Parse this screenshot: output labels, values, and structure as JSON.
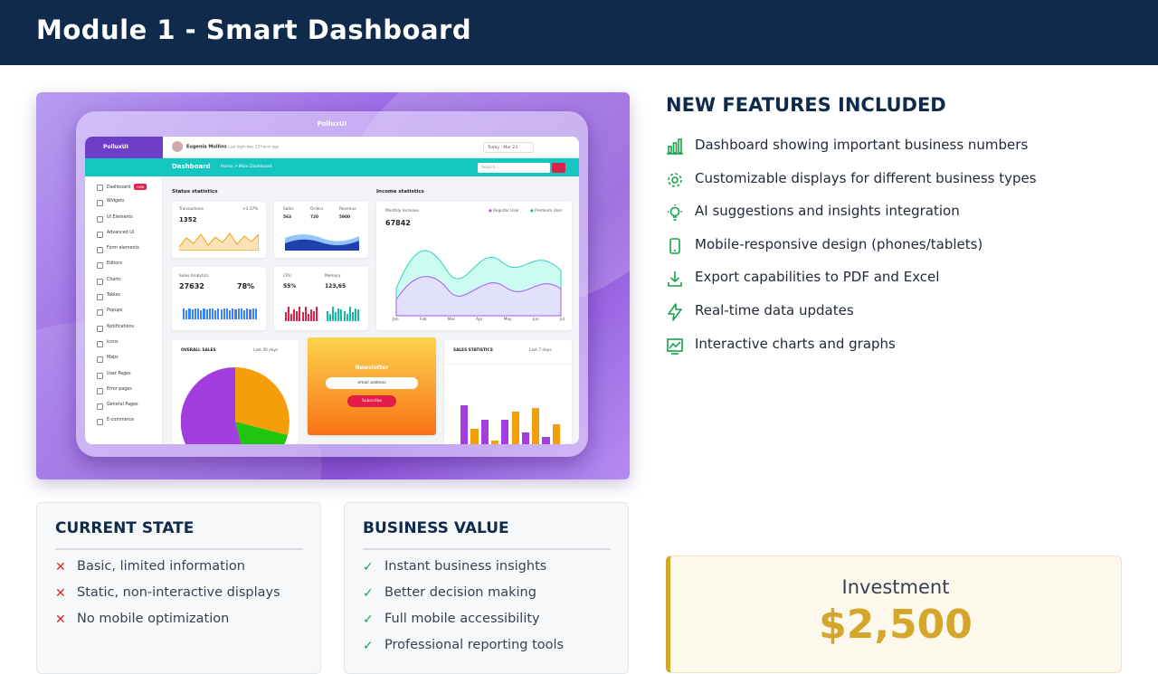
{
  "header": {
    "title": "Module 1 - Smart Dashboard"
  },
  "screenshot": {
    "brand": "PolluxUI",
    "top": {
      "user": "Eugenia Mullins",
      "last_login": "Last login was 23 hours ago",
      "date": "Today : Mar 23"
    },
    "nav": {
      "title": "Dashboard",
      "breadcrumb": "Home > Main Dashboard",
      "search_placeholder": "Search..."
    },
    "sidebar": [
      "Dashboard",
      "Widgets",
      "UI Elements",
      "Advanced UI",
      "Form elements",
      "Editors",
      "Charts",
      "Tables",
      "Popups",
      "Notifications",
      "Icons",
      "Maps",
      "User Pages",
      "Error pages",
      "General Pages",
      "E-commerce"
    ],
    "sidebar_badge": "new",
    "status_title": "Status statistics",
    "income_title": "Income statistics",
    "transactions": {
      "label": "Transactions",
      "value": "1352",
      "change": "+1.37%"
    },
    "sales_top": {
      "labels": [
        "Sales",
        "Orders",
        "Revenue"
      ],
      "values": [
        "563",
        "720",
        "5900"
      ]
    },
    "sales_analytics": {
      "label": "Sales Analytics",
      "value": "27632",
      "pct": "78%"
    },
    "cpu": {
      "label": "CPU",
      "value": "55%"
    },
    "memory": {
      "label": "Memory",
      "value": "123,65"
    },
    "monthly": {
      "label": "Monthly Increase",
      "value": "67842",
      "legend": [
        "Register User",
        "Premium User"
      ],
      "months": [
        "Jan",
        "Feb",
        "Mar",
        "Apr",
        "May",
        "Jun",
        "Jul"
      ]
    },
    "overall_sales": {
      "label": "OVERALL SALES",
      "range": "Last 30 days"
    },
    "newsletter": {
      "title": "Newsletter",
      "input": "email address",
      "button": "Subscribe"
    },
    "sales_statistics": {
      "label": "SALES STATISTICS",
      "range": "Last 7 days"
    }
  },
  "features": {
    "title": "NEW FEATURES INCLUDED",
    "items": [
      {
        "icon": "bar-chart-icon",
        "text": "Dashboard showing important business numbers"
      },
      {
        "icon": "gear-icon",
        "text": "Customizable displays for different business types"
      },
      {
        "icon": "lightbulb-icon",
        "text": "AI suggestions and insights integration"
      },
      {
        "icon": "mobile-icon",
        "text": "Mobile-responsive design (phones/tablets)"
      },
      {
        "icon": "download-icon",
        "text": "Export capabilities to PDF and Excel"
      },
      {
        "icon": "lightning-icon",
        "text": "Real-time data updates"
      },
      {
        "icon": "chart-line-icon",
        "text": "Interactive charts and graphs"
      }
    ],
    "accent": "#16a34a"
  },
  "current_state": {
    "title": "CURRENT STATE",
    "items": [
      "Basic, limited information",
      "Static, non-interactive displays",
      "No mobile optimization"
    ]
  },
  "business_value": {
    "title": "BUSINESS VALUE",
    "items": [
      "Instant business insights",
      "Better decision making",
      "Full mobile accessibility",
      "Professional reporting tools"
    ]
  },
  "investment": {
    "label": "Investment",
    "amount": "$2,500",
    "color": "#d4a72c"
  }
}
